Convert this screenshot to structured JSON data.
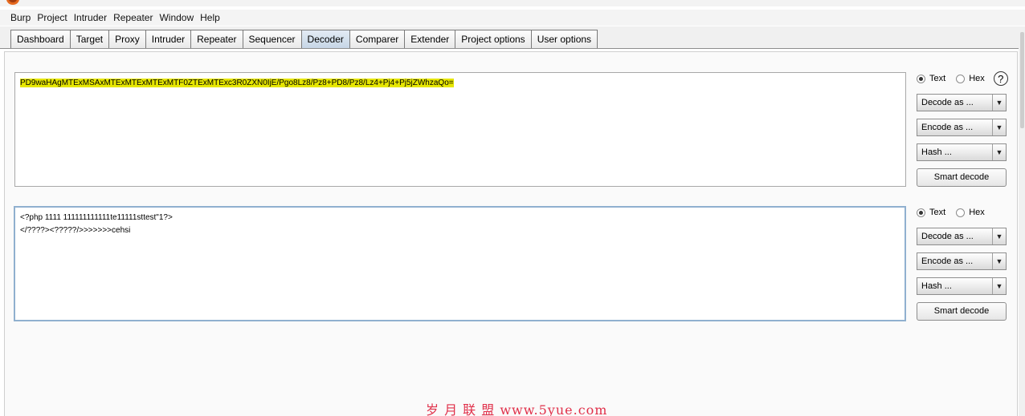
{
  "menu": [
    "Burp",
    "Project",
    "Intruder",
    "Repeater",
    "Window",
    "Help"
  ],
  "tabs": [
    {
      "label": "Dashboard"
    },
    {
      "label": "Target"
    },
    {
      "label": "Proxy"
    },
    {
      "label": "Intruder"
    },
    {
      "label": "Repeater"
    },
    {
      "label": "Sequencer"
    },
    {
      "label": "Decoder",
      "active": true
    },
    {
      "label": "Comparer"
    },
    {
      "label": "Extender"
    },
    {
      "label": "Project options"
    },
    {
      "label": "User options"
    }
  ],
  "decoder": {
    "input_text": "PD9waHAgMTExMSAxMTExMTExMTExMTF0ZTExMTExc3R0ZXN0IjE/Pgo8Lz8/Pz8+PD8/Pz8/Lz4+Pj4+Pj5jZWhzaQo=",
    "output_line1": "<?php 1111 111111111111te11111sttest\"1?>",
    "output_line2": "</????><?????/>>>>>>>cehsi",
    "controls": {
      "text_label": "Text",
      "hex_label": "Hex",
      "help_glyph": "?",
      "decode_as": "Decode as ...",
      "encode_as": "Encode as ...",
      "hash": "Hash ...",
      "smart_decode": "Smart decode",
      "dropdown_arrow": "▼"
    },
    "top_panel_mode": "Text",
    "bottom_panel_mode": "Text"
  },
  "watermark": {
    "text": "岁 月 联 盟  www.5yue.com"
  },
  "colors": {
    "selection_highlight": "#e6e600",
    "active_tab": "#c6d6e6",
    "watermark": "#e0304a"
  }
}
